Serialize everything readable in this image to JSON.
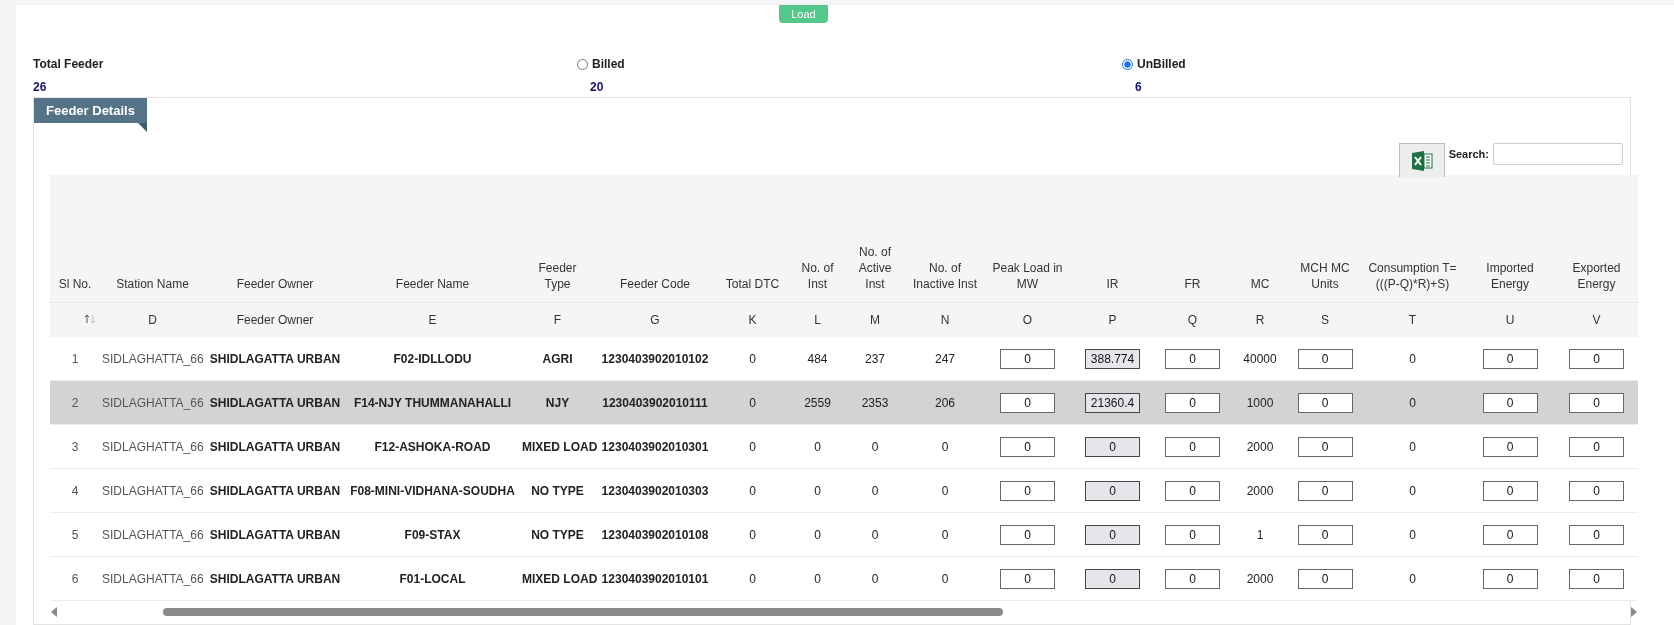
{
  "load_button": "Load",
  "summary": [
    {
      "label": "Total Feeder",
      "value": "26",
      "kind": "plain"
    },
    {
      "label": "Billed",
      "value": "20",
      "kind": "radio",
      "selected": false
    },
    {
      "label": "UnBilled",
      "value": "6",
      "kind": "radio",
      "selected": true
    }
  ],
  "panel": {
    "title": "Feeder Details",
    "search_label": "Search:"
  },
  "table": {
    "columns": [
      {
        "label": "Sl No.",
        "kind": "index",
        "sortable": true
      },
      {
        "label": "Station Name",
        "sub": "D",
        "kind": "muted"
      },
      {
        "label": "Feeder Owner",
        "sub": "Feeder Owner",
        "kind": "strong"
      },
      {
        "label": "Feeder Name",
        "sub": "E",
        "kind": "strong"
      },
      {
        "label": "Feeder Type",
        "sub": "F",
        "kind": "strong"
      },
      {
        "label": "Feeder Code",
        "sub": "G",
        "kind": "strong"
      },
      {
        "label": "Total DTC",
        "sub": "K",
        "kind": "number"
      },
      {
        "label": "No. of Inst",
        "sub": "L",
        "kind": "number"
      },
      {
        "label": "No. of Active Inst",
        "sub": "M",
        "kind": "number"
      },
      {
        "label": "No. of Inactive Inst",
        "sub": "N",
        "kind": "number"
      },
      {
        "label": "Peak Load in MW",
        "sub": "O",
        "kind": "input"
      },
      {
        "label": "IR",
        "sub": "P",
        "kind": "locked"
      },
      {
        "label": "FR",
        "sub": "Q",
        "kind": "input"
      },
      {
        "label": "MC",
        "sub": "R",
        "kind": "number"
      },
      {
        "label": "MCH MC Units",
        "sub": "S",
        "kind": "input"
      },
      {
        "label": "Consumption T=(((P-Q)*R)+S)",
        "sub": "T",
        "kind": "number"
      },
      {
        "label": "Imported Energy",
        "sub": "U",
        "kind": "input"
      },
      {
        "label": "Exported Energy",
        "sub": "V",
        "kind": "input"
      }
    ],
    "rows": [
      {
        "selected": false,
        "cells": [
          "1",
          "SIDLAGHATTA_66",
          "SHIDLAGATTA URBAN",
          "F02-IDLLODU",
          "AGRI",
          "1230403902010102",
          "0",
          "484",
          "237",
          "247",
          "0",
          "388.774",
          "0",
          "40000",
          "0",
          "0",
          "0",
          "0"
        ]
      },
      {
        "selected": true,
        "cells": [
          "2",
          "SIDLAGHATTA_66",
          "SHIDLAGATTA URBAN",
          "F14-NJY THUMMANAHALLI",
          "NJY",
          "1230403902010111",
          "0",
          "2559",
          "2353",
          "206",
          "0",
          "21360.4",
          "0",
          "1000",
          "0",
          "0",
          "0",
          "0"
        ]
      },
      {
        "selected": false,
        "cells": [
          "3",
          "SIDLAGHATTA_66",
          "SHIDLAGATTA URBAN",
          "F12-ASHOKA-ROAD",
          "MIXED LOAD",
          "1230403902010301",
          "0",
          "0",
          "0",
          "0",
          "0",
          "0",
          "0",
          "2000",
          "0",
          "0",
          "0",
          "0"
        ]
      },
      {
        "selected": false,
        "cells": [
          "4",
          "SIDLAGHATTA_66",
          "SHIDLAGATTA URBAN",
          "F08-MINI-VIDHANA-SOUDHA",
          "NO TYPE",
          "1230403902010303",
          "0",
          "0",
          "0",
          "0",
          "0",
          "0",
          "0",
          "2000",
          "0",
          "0",
          "0",
          "0"
        ]
      },
      {
        "selected": false,
        "cells": [
          "5",
          "SIDLAGHATTA_66",
          "SHIDLAGATTA URBAN",
          "F09-STAX",
          "NO TYPE",
          "1230403902010108",
          "0",
          "0",
          "0",
          "0",
          "0",
          "0",
          "0",
          "1",
          "0",
          "0",
          "0",
          "0"
        ]
      },
      {
        "selected": false,
        "cells": [
          "6",
          "SIDLAGHATTA_66",
          "SHIDLAGATTA URBAN",
          "F01-LOCAL",
          "MIXED LOAD",
          "1230403902010101",
          "0",
          "0",
          "0",
          "0",
          "0",
          "0",
          "0",
          "2000",
          "0",
          "0",
          "0",
          "0"
        ]
      }
    ]
  }
}
